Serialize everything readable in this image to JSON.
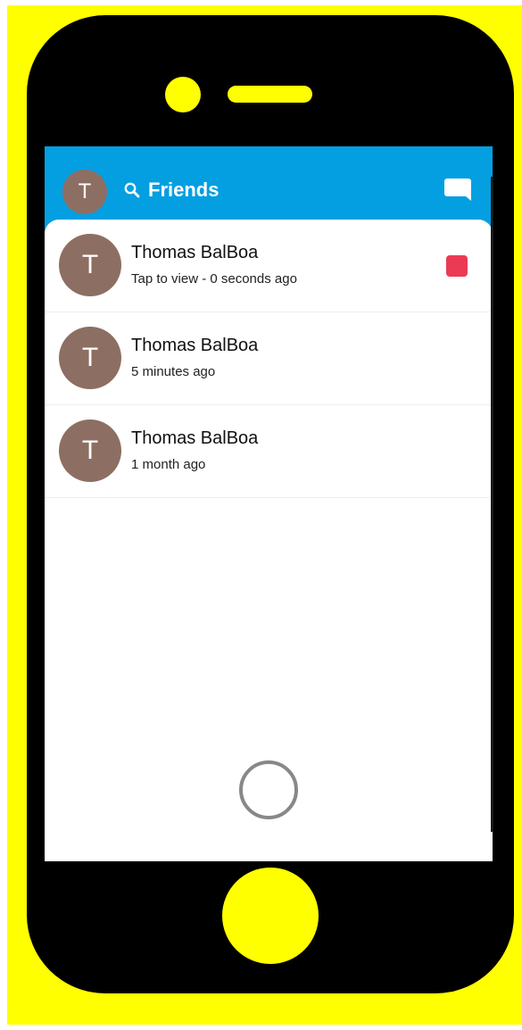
{
  "colors": {
    "frame": "#FFFF00",
    "phone": "#000000",
    "header_bg": "#049FE1",
    "avatar_bg": "#8D6E63",
    "unread": "#EC3A55",
    "capture_ring": "#888888"
  },
  "header": {
    "avatar_initial": "T",
    "search_icon": "search-icon",
    "title": "Friends",
    "chat_icon": "chat-bubble-icon"
  },
  "friends": [
    {
      "initial": "T",
      "name": "Thomas BalBoa",
      "status": "Tap to view - 0 seconds ago",
      "unread": true
    },
    {
      "initial": "T",
      "name": "Thomas BalBoa",
      "status": "5 minutes ago",
      "unread": false
    },
    {
      "initial": "T",
      "name": "Thomas BalBoa",
      "status": "1 month ago",
      "unread": false
    }
  ]
}
